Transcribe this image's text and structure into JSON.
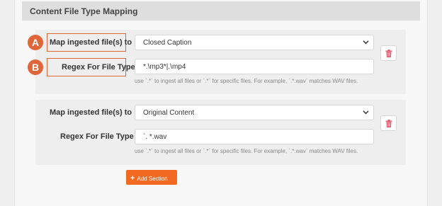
{
  "section": {
    "title": "Content File Type Mapping"
  },
  "mappings": [
    {
      "callout_map": "A",
      "callout_regex": "B",
      "map_label": "Map ingested file(s) to",
      "map_value": "Closed Caption",
      "regex_label": "Regex For File Type",
      "regex_value": "*.\\mp3*|.\\mp4",
      "help_text": "use `.*` to ingest all files or `.*` for specific files. For example, `.*.wav` matches WAV files."
    },
    {
      "map_label": "Map ingested file(s) to",
      "map_value": "Original Content",
      "regex_label": "Regex For File Type",
      "regex_value": "`. *.wav",
      "help_text": "use `.*` to ingest all files or `.*` for specific files. For example, `.*.wav` matches WAV files."
    }
  ],
  "add_section": {
    "label": "Add Section",
    "icon": "plus-icon"
  },
  "icons": {
    "select": "chevron-down-icon",
    "delete": "trash-icon"
  },
  "colors": {
    "accent": "#f26a21",
    "callout": "#e0663a",
    "trash": "#e0566a"
  }
}
